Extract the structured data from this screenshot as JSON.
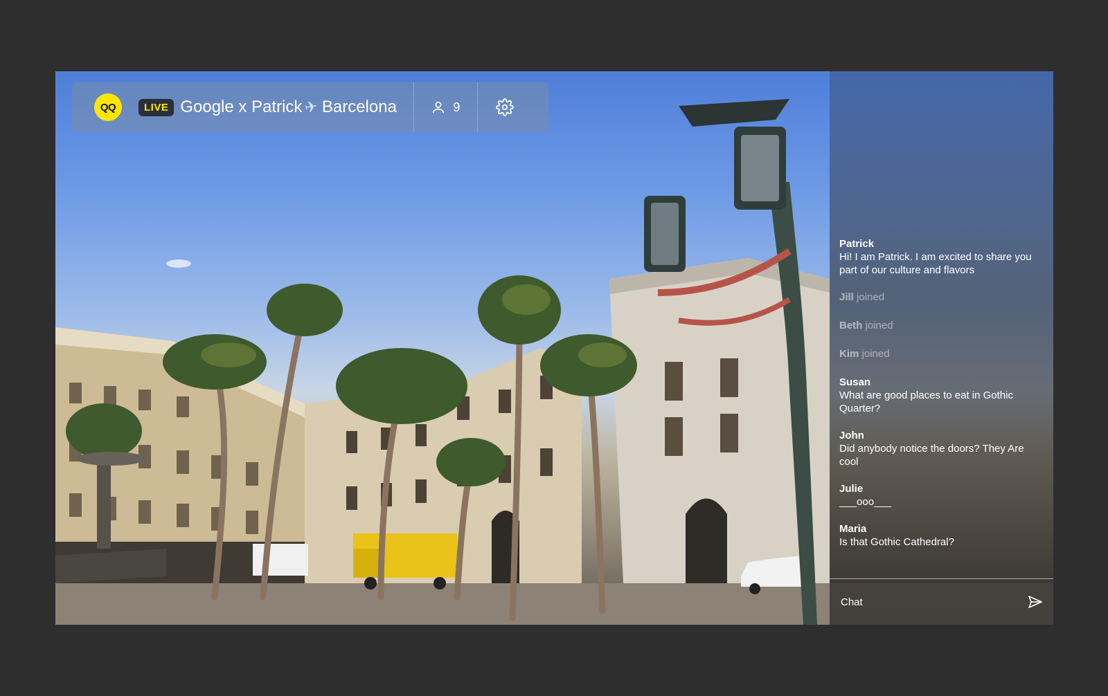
{
  "stream": {
    "logo_text": "QQ",
    "live_label": "LIVE",
    "title_part1": "Google x Patrick",
    "title_part2": "Barcelona",
    "viewer_count": "9",
    "plane_icon": "airplane-icon"
  },
  "chat": {
    "messages": [
      {
        "type": "message",
        "user": "Patrick",
        "text": "Hi! I am Patrick. I am excited to share you part of our culture and flavors"
      },
      {
        "type": "join",
        "user": "Jill",
        "verb": "joined"
      },
      {
        "type": "join",
        "user": "Beth",
        "verb": "joined"
      },
      {
        "type": "join",
        "user": "Kim",
        "verb": "joined"
      },
      {
        "type": "message",
        "user": "Susan",
        "text": "What are good places to eat in Gothic Quarter?"
      },
      {
        "type": "message",
        "user": "John",
        "text": "Did anybody notice the doors? They Are cool"
      },
      {
        "type": "message",
        "user": "Julie",
        "text": "___ooo___"
      },
      {
        "type": "message",
        "user": "Maria",
        "text": "Is that Gothic Cathedral?"
      }
    ],
    "input_placeholder": "Chat"
  },
  "colors": {
    "accent": "#ffe600",
    "background": "#2e2e2e"
  }
}
